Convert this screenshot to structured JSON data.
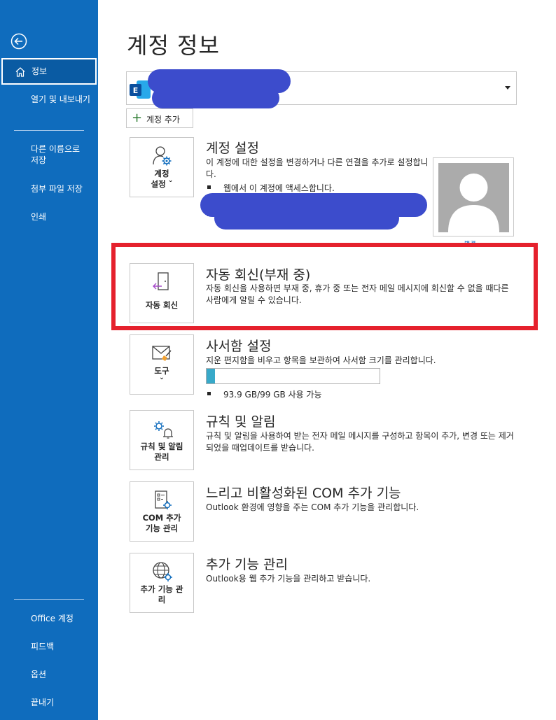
{
  "sidebar": {
    "back_icon": "back-arrow-icon",
    "items": [
      {
        "label": "정보",
        "selected": true,
        "icon": "home-icon"
      },
      {
        "label": "열기 및 내보내기"
      },
      {
        "label": "다른 이름으로 저장"
      },
      {
        "label": "첨부 파일 저장"
      },
      {
        "label": "인쇄"
      }
    ],
    "bottom_items": [
      {
        "label": "Office 계정"
      },
      {
        "label": "피드백"
      },
      {
        "label": "옵션"
      },
      {
        "label": "끝내기"
      }
    ],
    "color": "#0f6cbd"
  },
  "page_title": "계정 정보",
  "account": {
    "icon": "exchange-icon",
    "caret_icon": "chevron-down-icon",
    "add_account_label": "계정 추가"
  },
  "sections": {
    "account_settings": {
      "button_label_1": "계정",
      "button_label_2": "설정 ˇ",
      "title": "계정 설정",
      "description": "이 계정에 대한 설정을 변경하거나 다른 연결을 추가로 설정합니다.",
      "bullet_1": "웹에서 이 계정에 액세스합니다.",
      "change_label": "변경"
    },
    "auto_reply": {
      "button_label": "자동 회신",
      "title": "자동 회신(부재 중)",
      "description": "자동 회신을 사용하면 부재 중, 휴가 중 또는 전자 메일 메시지에 회신할 수 없을 때다른 사람에게 알릴 수 있습니다."
    },
    "mailbox": {
      "button_label_1": "도구",
      "button_label_2": "ˇ",
      "title": "사서함 설정",
      "description": "지운 편지함을 비우고 항목을 보관하여 사서함 크기를 관리합니다.",
      "storage_text": "93.9 GB/99 GB 사용 가능",
      "storage_used_fraction": 0.05
    },
    "rules": {
      "button_label_1": "규칙 및 알림",
      "button_label_2": "관리",
      "title": "규칙 및 알림",
      "description": "규칙 및 알림을 사용하여 받는 전자 메일 메시지를 구성하고 항목이 추가, 변경 또는 제거되었을 때업데이트를 받습니다."
    },
    "com_addins": {
      "button_label_1": "COM 추가",
      "button_label_2": "기능 관리",
      "title": "느리고 비활성화된 COM 추가 기능",
      "description": "Outlook 환경에 영향을 주는 COM 추가 기능을 관리합니다."
    },
    "manage_addins": {
      "button_label_1": "추가 기능 관",
      "button_label_2": "리",
      "title": "추가 기능 관리",
      "description": "Outlook용 웹 추가 기능을 관리하고 받습니다."
    }
  },
  "highlight_color": "#e5212d",
  "redaction_color": "#3c4ccc"
}
